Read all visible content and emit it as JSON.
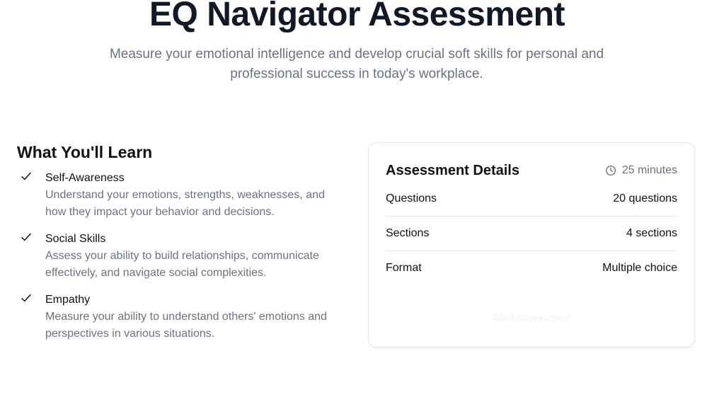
{
  "hero": {
    "title": "EQ Navigator Assessment",
    "subtitle": "Measure your emotional intelligence and develop crucial soft skills for personal and professional success in today's workplace."
  },
  "learn": {
    "heading": "What You'll Learn",
    "items": [
      {
        "title": "Self-Awareness",
        "description": "Understand your emotions, strengths, weaknesses, and how they impact your behavior and decisions."
      },
      {
        "title": "Social Skills",
        "description": "Assess your ability to build relationships, communicate effectively, and navigate social complexities."
      },
      {
        "title": "Empathy",
        "description": "Measure your ability to understand others' emotions and perspectives in various situations."
      }
    ],
    "icon": "check-icon"
  },
  "details": {
    "title": "Assessment Details",
    "duration": "25 minutes",
    "duration_icon": "clock-icon",
    "rows": [
      {
        "label": "Questions",
        "value": "20 questions"
      },
      {
        "label": "Sections",
        "value": "4 sections"
      },
      {
        "label": "Format",
        "value": "Multiple choice"
      }
    ],
    "start_label": "Start Assessment"
  },
  "colors": {
    "title": "#111827",
    "muted_text": "#6b7280",
    "border": "#e5e7eb",
    "faded_button_text": "#f0f1f3"
  }
}
